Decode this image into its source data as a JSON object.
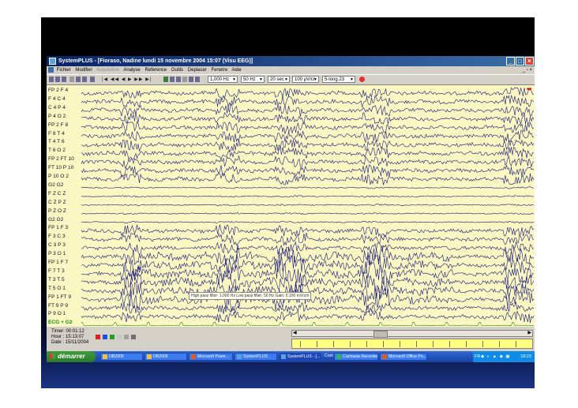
{
  "window": {
    "title": "SystemPLUS - [Fioraso, Nadine lundi 15 novembre 2004 15:07 (Visu EEG)]",
    "menu": [
      "Fichier",
      "Modifier",
      "Acquisition",
      "Analyse",
      "Reference",
      "Outils",
      "Deplacer",
      "Fenetre",
      "Aide"
    ]
  },
  "toolbar": {
    "speed": "1,000 Hz",
    "filter": "50 Hz",
    "duration": "20 sec",
    "gain": "100 µV/cr",
    "montage": "5-long.23"
  },
  "channels": [
    "FP 2 F 4",
    "F 4 C 4",
    "C 4 P 4",
    "P 4 O 2",
    "FP 2 F 8",
    "F 8 T 4",
    "T 4 T 6",
    "T 6 O 2",
    "FP 2 FT 10",
    "FT 10 P 10",
    "P 10 O 2",
    "G2 G2",
    "F Z C Z",
    "C Z P Z",
    "P Z O Z",
    "G2 G2",
    "FP 1 F 3",
    "F 3 C 3",
    "C 3 P 3",
    "P 3 O 1",
    "FP 1 F 7",
    "F 7 T 3",
    "T 3 T 5",
    "T 5 O 1",
    "FP 1 FT 9",
    "FT 9 P 9",
    "P 9 O 1",
    "ECG + G2"
  ],
  "eeg": {
    "info_tip": "High pass filter: 1.000 Hz    Low pass filter: 50 Hz    Gain: 0.100 mV/cm"
  },
  "status": {
    "timer": "Timer: 00:01:12",
    "hour": "Hour : 15:13:07",
    "date": "Date : 15/11/2004"
  },
  "taskbar": {
    "start_label": "démarrer",
    "tasks": [
      "DB2005",
      "DB2005",
      "Microsoft Powe...",
      "SystemPLUS",
      "SystemPLUS - [...",
      "Com",
      "Camtasia Recorder",
      "Microsoft Office Po..."
    ],
    "tray_lang": "FR",
    "clock": "18:22"
  },
  "colors": {
    "trace": "#15157a",
    "ecg_label": "#1a8a1a",
    "eeg_background": "#fbf7c2"
  }
}
